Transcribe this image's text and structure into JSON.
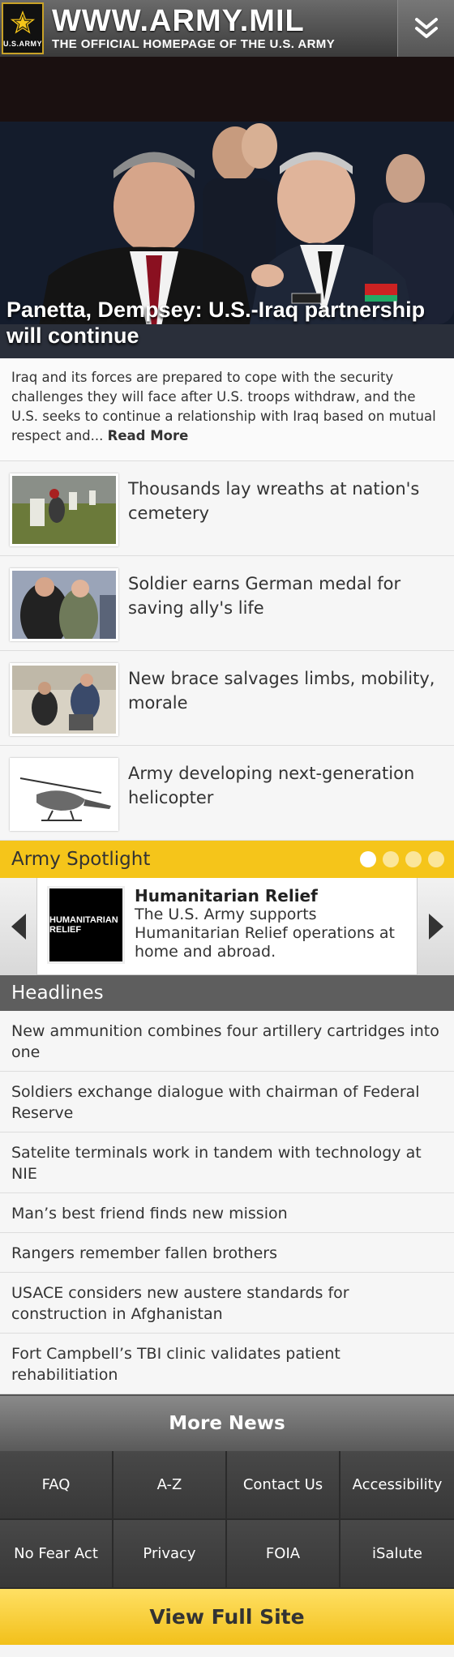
{
  "header": {
    "logo_text": "U.S.ARMY",
    "site_name": "WWW.ARMY.MIL",
    "tagline": "THE OFFICIAL HOMEPAGE OF THE U.S. ARMY",
    "menu_icon": "double-chevron-down-icon"
  },
  "hero": {
    "caption": "Panetta, Dempsey: U.S.-Iraq partnership will continue",
    "summary": "Iraq and its forces are prepared to cope with the security challenges they will face after U.S. troops withdraw, and the U.S. seeks to continue a relationship with Iraq based on mutual respect and...",
    "read_more": "Read More"
  },
  "stories": [
    {
      "title": "Thousands lay wreaths at nation's cemetery"
    },
    {
      "title": "Soldier earns German medal for saving ally's life"
    },
    {
      "title": "New brace salvages limbs, mobility, morale"
    },
    {
      "title": "Army developing next-generation helicopter"
    }
  ],
  "spotlight": {
    "label": "Army Spotlight",
    "image_text": "HUMANITARIAN RELIEF",
    "title": "Humanitarian Relief",
    "description": "The U.S. Army supports Humanitarian Relief operations at home and abroad.",
    "dots_total": 4,
    "dots_active": 1
  },
  "headlines": {
    "label": "Headlines",
    "items": [
      "New ammunition combines four artillery cartridges into one",
      "Soldiers exchange dialogue with chairman of Federal Reserve",
      "Satelite terminals work in tandem with technology at NIE",
      "Man’s best friend finds new mission",
      "Rangers remember fallen brothers",
      "USACE considers new austere standards for construction in Afghanistan",
      "Fort Campbell’s TBI clinic validates patient rehabilitiation"
    ]
  },
  "more_news": "More News",
  "footer": {
    "links": [
      "FAQ",
      "A-Z",
      "Contact Us",
      "Accessibility",
      "No Fear Act",
      "Privacy",
      "FOIA",
      "iSalute"
    ]
  },
  "full_site": "View Full Site",
  "colors": {
    "accent": "#f5c51a",
    "header_dark": "#3a3a3a",
    "footer_dark": "#3b3b3b"
  }
}
